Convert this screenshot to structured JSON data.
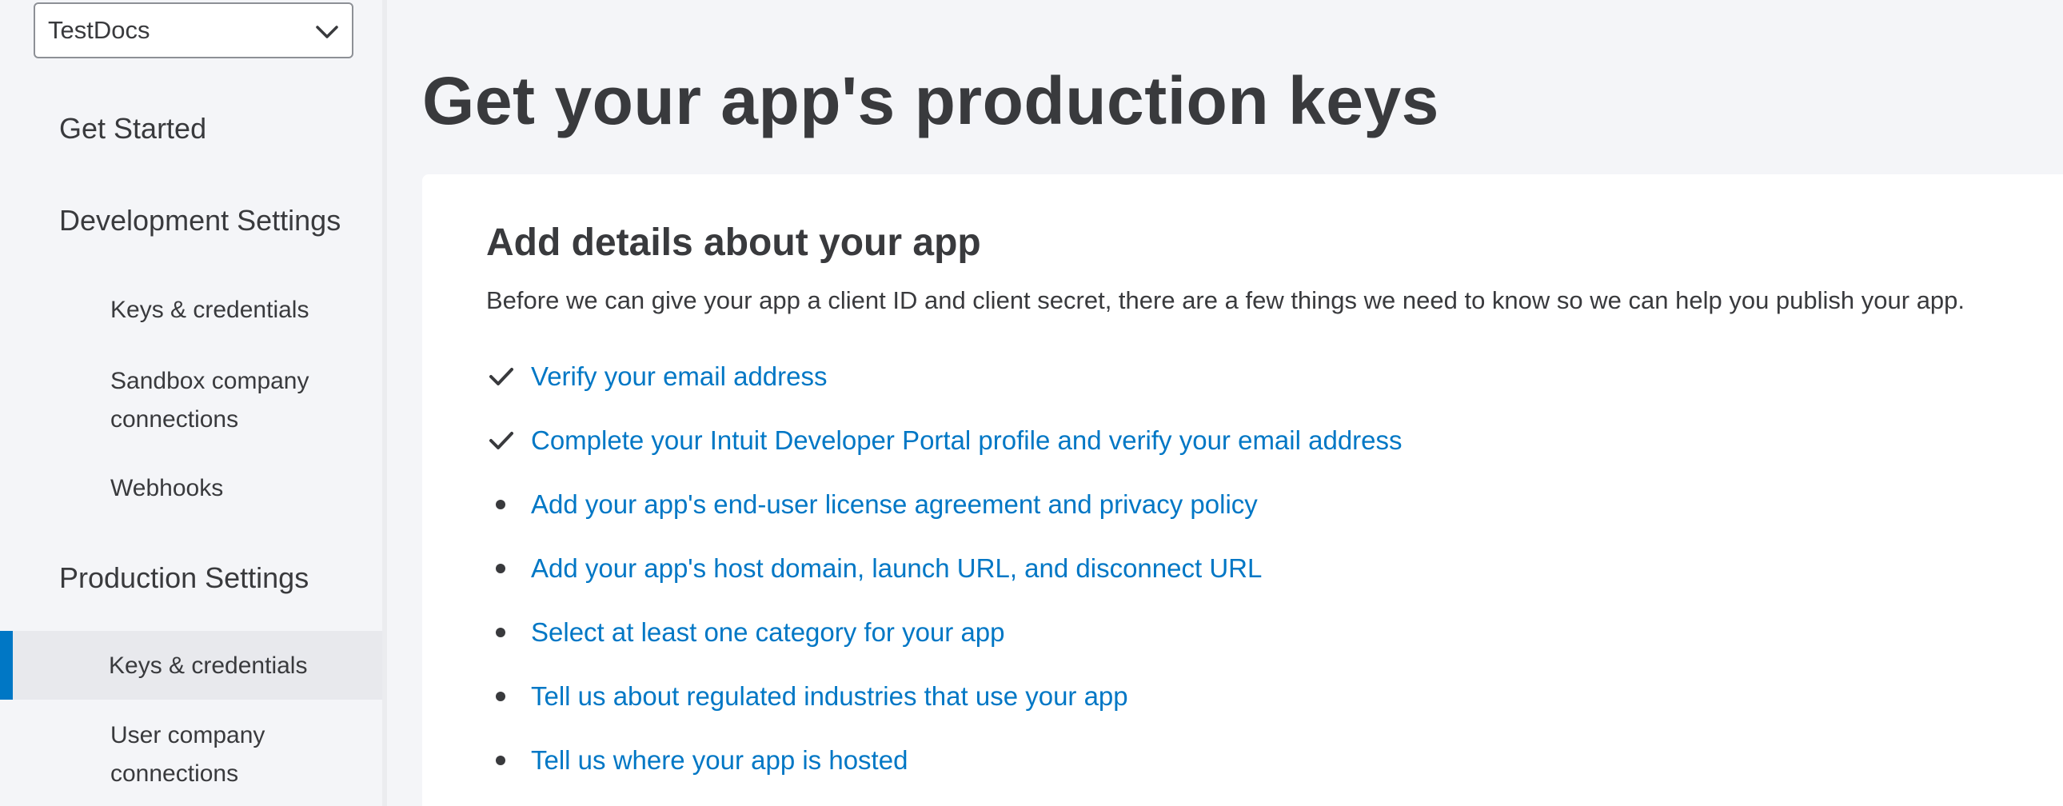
{
  "app_selector": {
    "value": "TestDocs",
    "icon": "chevron-down-icon"
  },
  "sidebar": {
    "sections": [
      {
        "label": "Get Started"
      },
      {
        "label": "Development Settings",
        "items": [
          {
            "label": "Keys & credentials"
          },
          {
            "label": "Sandbox company connections"
          },
          {
            "label": "Webhooks"
          }
        ]
      },
      {
        "label": "Production Settings",
        "items": [
          {
            "label": "Keys & credentials",
            "active": true
          },
          {
            "label": "User company connections"
          }
        ]
      }
    ]
  },
  "main": {
    "title": "Get your app's production keys",
    "card": {
      "title": "Add details about your app",
      "description": "Before we can give your app a client ID and client secret, there are a few things we need to know so we can help you publish your app.",
      "requirements": [
        {
          "label": "Verify your email address",
          "status": "done",
          "icon": "checkmark-icon"
        },
        {
          "label": "Complete your Intuit Developer Portal profile and verify your email address",
          "status": "done",
          "icon": "checkmark-icon"
        },
        {
          "label": "Add your app's end-user license agreement and privacy policy",
          "status": "todo",
          "icon": "bullet-icon"
        },
        {
          "label": "Add your app's host domain, launch URL, and disconnect URL",
          "status": "todo",
          "icon": "bullet-icon"
        },
        {
          "label": "Select at least one category for your app",
          "status": "todo",
          "icon": "bullet-icon"
        },
        {
          "label": "Tell us about regulated industries that use your app",
          "status": "todo",
          "icon": "bullet-icon"
        },
        {
          "label": "Tell us where your app is hosted",
          "status": "todo",
          "icon": "bullet-icon"
        }
      ]
    }
  },
  "colors": {
    "accent": "#0077c5",
    "text": "#393a3d",
    "background": "#f4f5f8",
    "card": "#ffffff"
  }
}
